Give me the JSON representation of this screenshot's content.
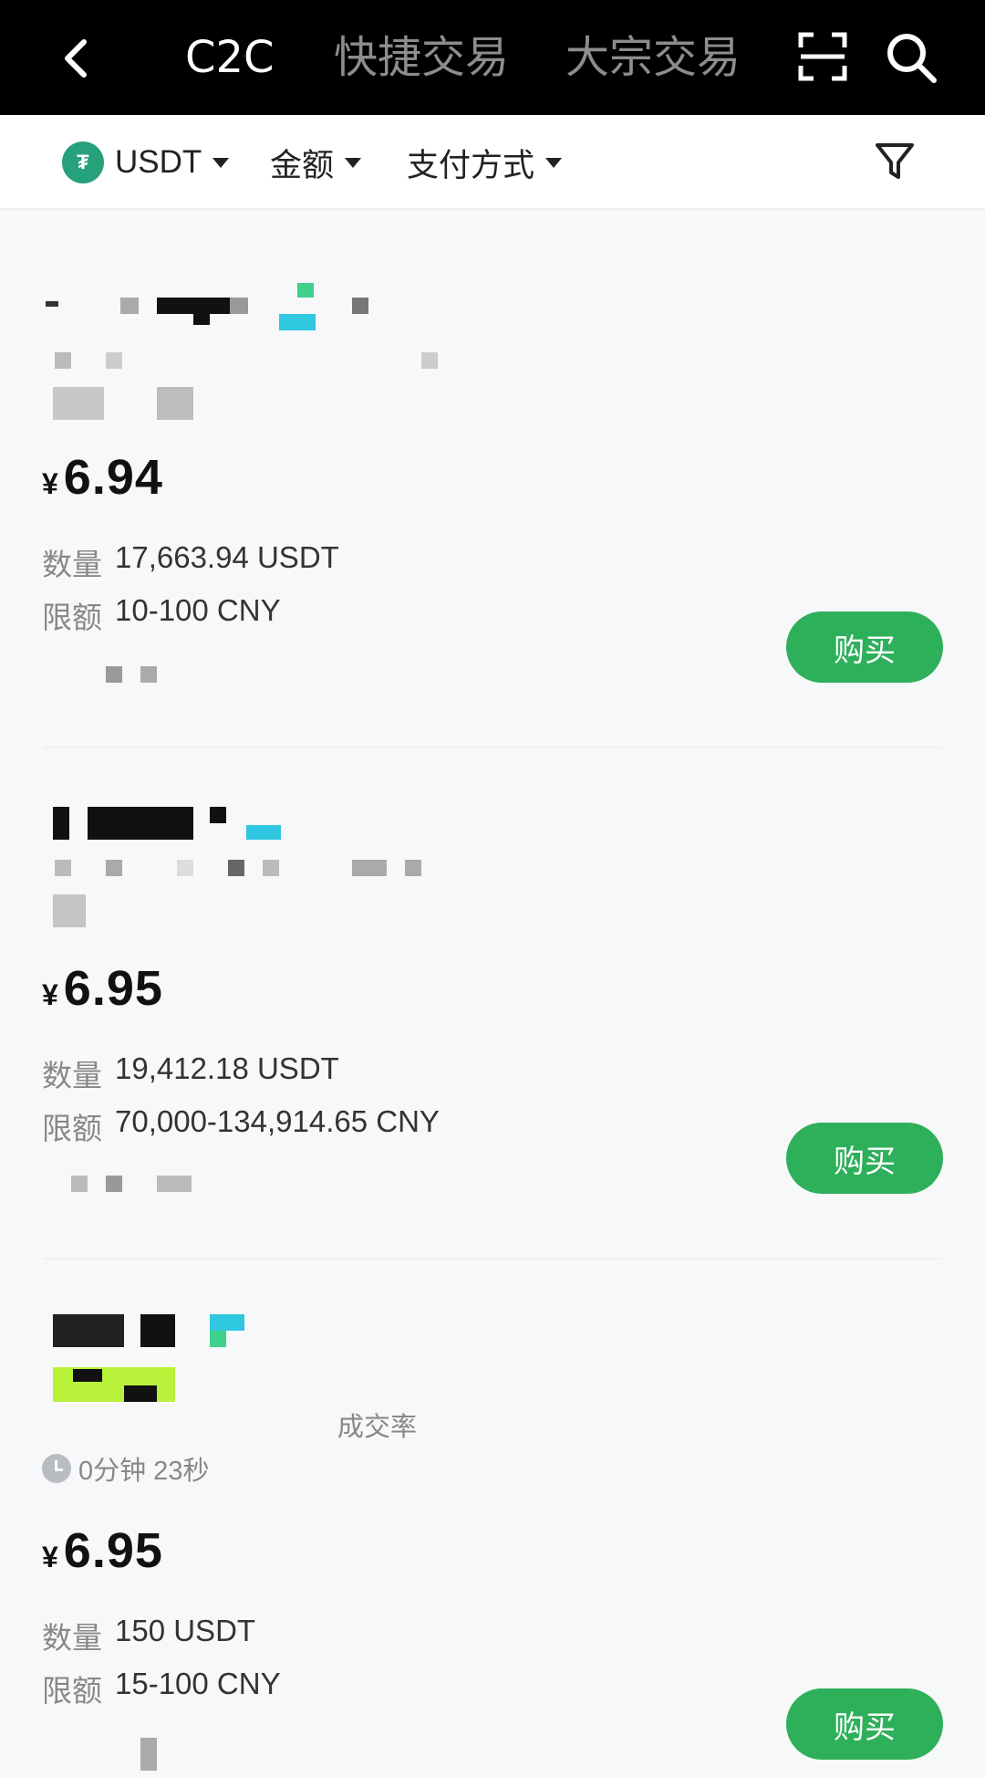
{
  "header": {
    "tabs": [
      {
        "label": "C2C",
        "active": true
      },
      {
        "label": "快捷交易",
        "active": false
      },
      {
        "label": "大宗交易",
        "active": false
      }
    ]
  },
  "filters": {
    "coin": "USDT",
    "amount": "金额",
    "payment": "支付方式"
  },
  "labels": {
    "quantity": "数量",
    "limit": "限额",
    "buy": "购买",
    "currency_symbol": "¥"
  },
  "listings": [
    {
      "price": "6.94",
      "quantity": "17,663.94 USDT",
      "limit": "10-100 CNY"
    },
    {
      "price": "6.95",
      "quantity": "19,412.18 USDT",
      "limit": "70,000-134,914.65 CNY"
    },
    {
      "price": "6.95",
      "quantity": "150 USDT",
      "limit": "15-100 CNY",
      "completion_label": "成交率",
      "pay_time": "0分钟 23秒"
    }
  ],
  "colors": {
    "buy_button": "#2eb05a",
    "header_bg": "#000000",
    "coin_logo": "#26a17b"
  }
}
